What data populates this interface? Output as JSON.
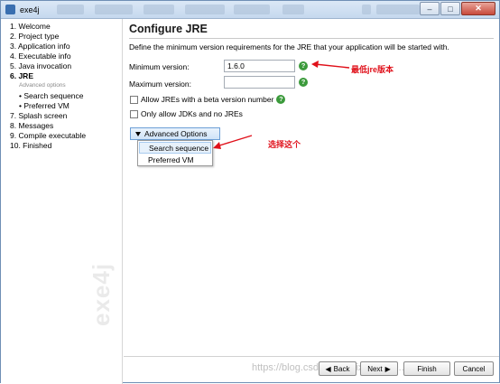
{
  "window": {
    "title": "exe4j",
    "controls": {
      "minimize": "–",
      "maximize": "□",
      "close": "✕"
    }
  },
  "sidebar": {
    "steps": [
      {
        "label": "1. Welcome",
        "state": "normal"
      },
      {
        "label": "2. Project type",
        "state": "normal"
      },
      {
        "label": "3. Application info",
        "state": "normal"
      },
      {
        "label": "4. Executable info",
        "state": "normal"
      },
      {
        "label": "5. Java invocation",
        "state": "normal"
      },
      {
        "label": "6. JRE",
        "state": "active"
      },
      {
        "label": "Advanced options",
        "state": "subheader"
      },
      {
        "label": "• Search sequence",
        "state": "sub"
      },
      {
        "label": "• Preferred VM",
        "state": "sub"
      },
      {
        "label": "7. Splash screen",
        "state": "normal"
      },
      {
        "label": "8. Messages",
        "state": "normal"
      },
      {
        "label": "9. Compile executable",
        "state": "normal"
      },
      {
        "label": "10. Finished",
        "state": "normal"
      }
    ],
    "brand": "exe4j"
  },
  "main": {
    "heading": "Configure JRE",
    "description": "Define the minimum version requirements for the JRE that your application will be started with.",
    "min_version_label": "Minimum version:",
    "min_version_value": "1.6.0",
    "max_version_label": "Maximum version:",
    "max_version_value": "",
    "allow_beta_label": "Allow JREs with a beta version number",
    "only_jdk_label": "Only allow JDKs and no JREs",
    "advanced_button_label": "Advanced Options",
    "advanced_menu": [
      "Search sequence",
      "Preferred VM"
    ],
    "help_glyph": "?"
  },
  "annotations": {
    "min_version_note": "最低jre版本",
    "choose_note": "选择这个",
    "color": "#e0101a"
  },
  "footer": {
    "back_label": "Back",
    "next_label": "Next",
    "finish_label": "Finish",
    "cancel_label": "Cancel",
    "watermark": "https://blog.csdn.net/weixin_4359..."
  }
}
